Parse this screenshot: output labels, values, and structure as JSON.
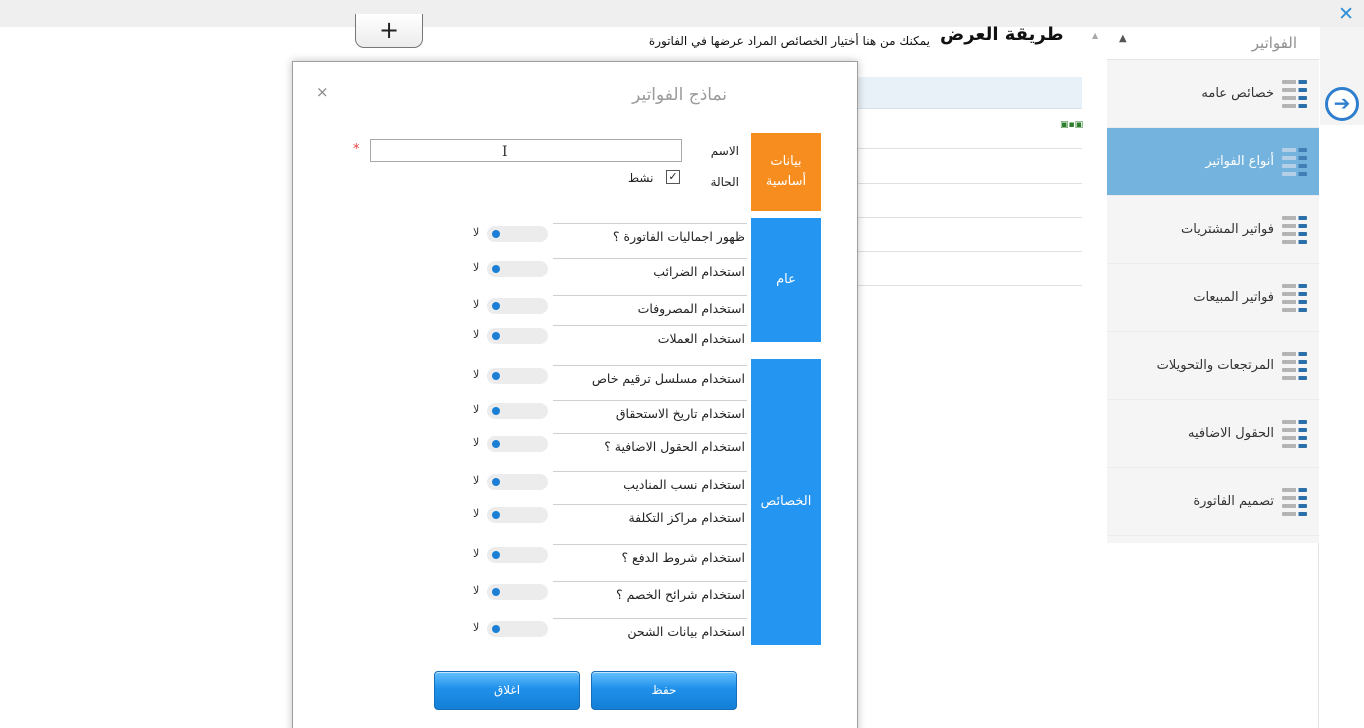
{
  "app": {
    "brand_icon": "x-logo-icon"
  },
  "nav": {
    "arrow_icon": "arrow-right-circle-icon"
  },
  "sidebar": {
    "header": "الفواتير",
    "items": [
      {
        "label": "خصائص عامه",
        "icon": "list-icon",
        "active": false
      },
      {
        "label": "أنواع الفواتير",
        "icon": "list-icon",
        "active": true
      },
      {
        "label": "فواتير المشتريات",
        "icon": "list-icon",
        "active": false
      },
      {
        "label": "فواتير المبيعات",
        "icon": "list-icon",
        "active": false
      },
      {
        "label": "المرتجعات والتحويلات",
        "icon": "list-icon",
        "active": false
      },
      {
        "label": "الحقول الاضافيه",
        "icon": "list-icon",
        "active": false
      },
      {
        "label": "تصميم الفاتورة",
        "icon": "list-icon",
        "active": false
      }
    ]
  },
  "background": {
    "title": "طريقة العرض",
    "subtitle": "يمكنك من هنا أختيار الخصائص المراد عرضها في الفاتورة",
    "add_label": "+"
  },
  "modal": {
    "title": "نماذج الفواتير",
    "close": "×",
    "sections": {
      "basic": "بيانات أساسية",
      "general": "عام",
      "properties": "الخصائص"
    },
    "basic": {
      "name_label": "الاسم",
      "name_value": "",
      "required_mark": "*",
      "status_label": "الحالة",
      "active_label": "نشط",
      "active_checked": true
    },
    "toggle_off_label": "لا",
    "general_rows": [
      {
        "label": "ظهور اجماليات الفاتورة ؟",
        "value": false
      },
      {
        "label": "استخدام الضرائب",
        "value": false
      },
      {
        "label": "استخدام المصروفات",
        "value": false
      },
      {
        "label": "استخدام العملات",
        "value": false
      }
    ],
    "property_rows": [
      {
        "label": "استخدام مسلسل ترقيم خاص",
        "value": false
      },
      {
        "label": "استخدام تاريخ الاستحقاق",
        "value": false
      },
      {
        "label": "استخدام الحقول الاضافية ؟",
        "value": false
      },
      {
        "label": "استخدام نسب المناديب",
        "value": false
      },
      {
        "label": "استخدام مراكز التكلفة",
        "value": false
      },
      {
        "label": "استخدام شروط الدفع ؟",
        "value": false
      },
      {
        "label": "استخدام شرائح الخصم ؟",
        "value": false
      },
      {
        "label": "استخدام بيانات الشحن",
        "value": false
      }
    ],
    "buttons": {
      "save": "حفظ",
      "close": "اغلاق"
    }
  },
  "colors": {
    "accent": "#2595f2",
    "basic_section": "#f68d1e",
    "sidebar_active": "#74b3de"
  }
}
